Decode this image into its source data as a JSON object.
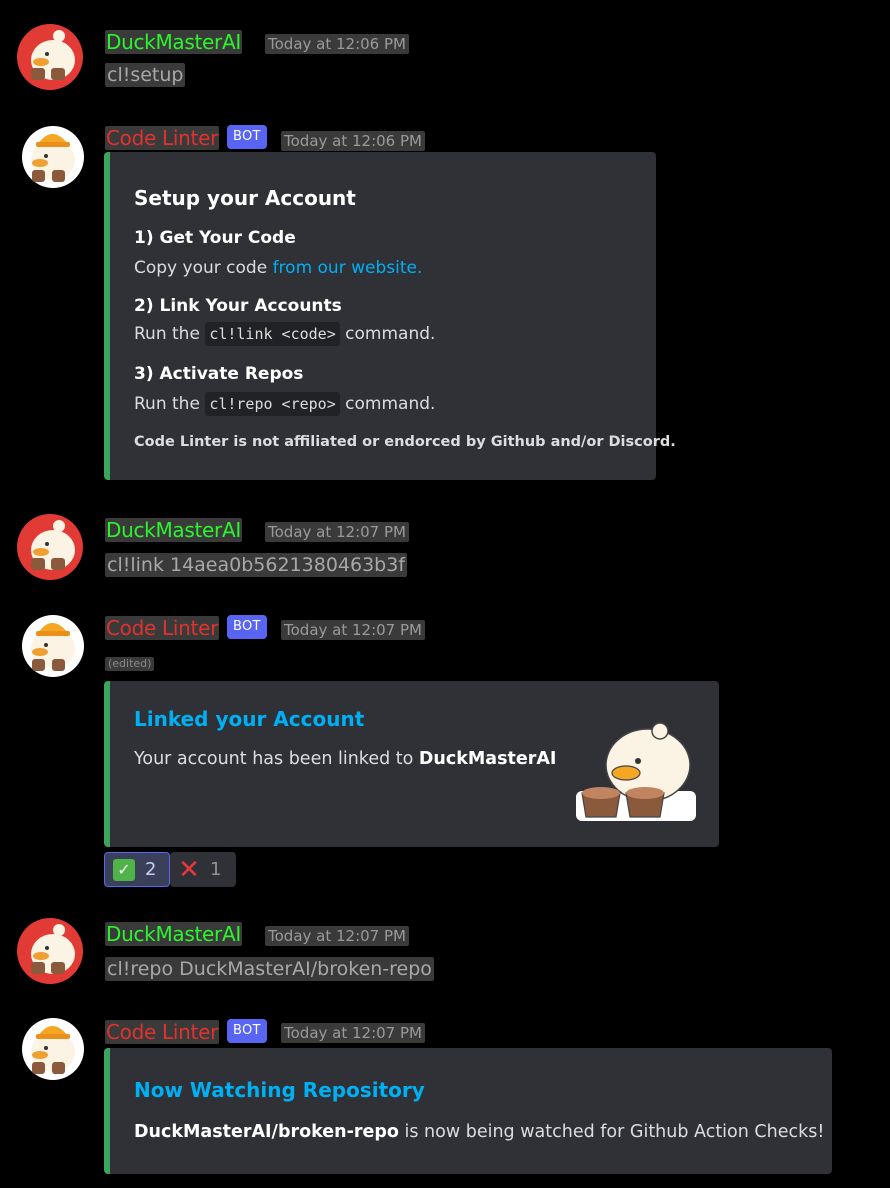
{
  "colors": {
    "user_name": "#2cf52c",
    "bot_name": "#e0322f",
    "embed_accent": "#3ba55d",
    "link": "#00b0f4",
    "badge": "#5865f2",
    "embed_bg": "#2f3136"
  },
  "messages": [
    {
      "author": "DuckMasterAI",
      "time": "Today at 12:06 PM",
      "text": "cl!setup"
    },
    {
      "author": "Code Linter",
      "badge": "BOT",
      "time": "Today at 12:06 PM",
      "embed": {
        "title": "Setup your Account",
        "fields": [
          {
            "name": "1) Get Your Code",
            "value_pre": "Copy your code ",
            "value_link": "from our website.",
            "value_post": ""
          },
          {
            "name": "2) Link Your Accounts",
            "value_pre": "Run the ",
            "value_code": "cl!link <code>",
            "value_post": " command."
          },
          {
            "name": "3) Activate Repos",
            "value_pre": "Run the ",
            "value_code": "cl!repo <repo>",
            "value_post": " command."
          }
        ],
        "footer": "Code Linter is not affiliated or endorced by Github and/or Discord."
      }
    },
    {
      "author": "DuckMasterAI",
      "time": "Today at 12:07 PM",
      "text": "cl!link 14aea0b5621380463b3f"
    },
    {
      "author": "Code Linter",
      "badge": "BOT",
      "time": "Today at 12:07 PM",
      "edited": "(edited)",
      "embed": {
        "title": "Linked your Account",
        "desc_pre": "Your account has been linked to ",
        "desc_bold": "DuckMasterAI"
      },
      "reactions": [
        {
          "emoji": "check-mark",
          "count": "2",
          "active": true
        },
        {
          "emoji": "cross-mark",
          "count": "1",
          "active": false
        }
      ]
    },
    {
      "author": "DuckMasterAI",
      "time": "Today at 12:07 PM",
      "text": "cl!repo DuckMasterAI/broken-repo"
    },
    {
      "author": "Code Linter",
      "badge": "BOT",
      "time": "Today at 12:07 PM",
      "embed": {
        "title": "Now Watching Repository",
        "desc_bold": "DuckMasterAI/broken-repo",
        "desc_post": " is now being watched for Github Action Checks!"
      }
    }
  ]
}
